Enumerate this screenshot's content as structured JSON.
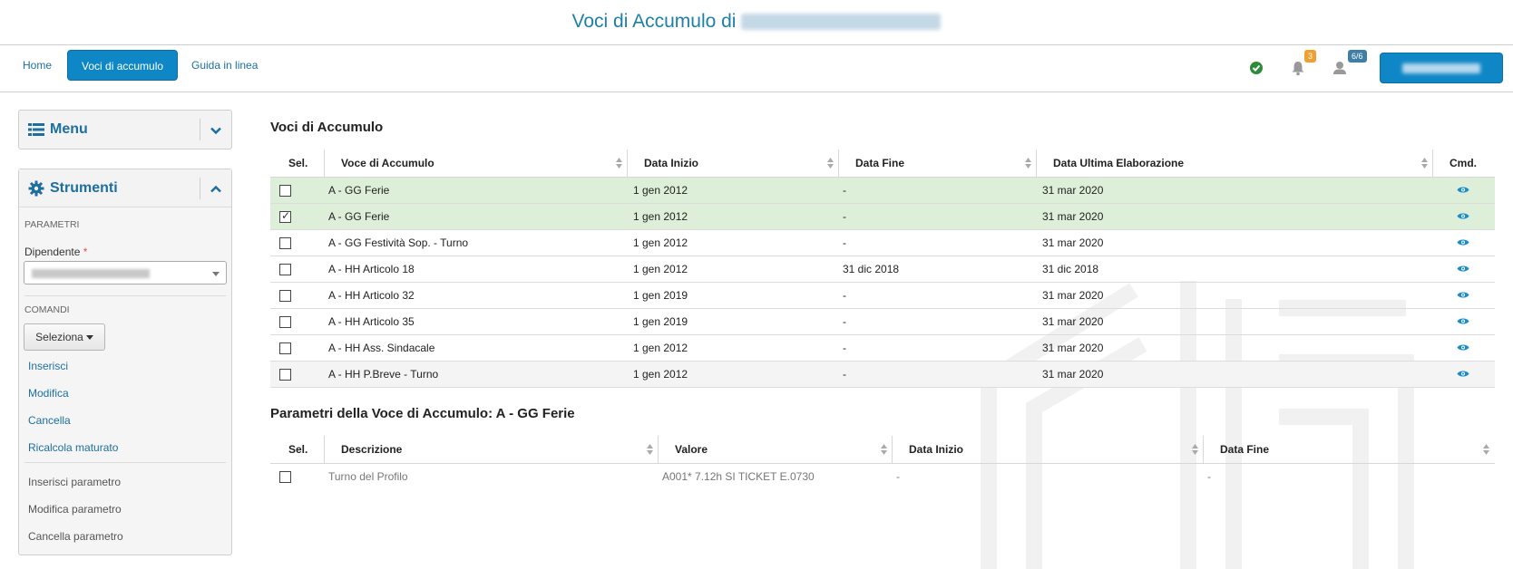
{
  "header": {
    "title": "Voci di Accumulo di"
  },
  "nav": {
    "home": "Home",
    "voci": "Voci di accumulo",
    "guida": "Guida in linea",
    "notifications_count": "3",
    "users_count": "6/6"
  },
  "sidebar": {
    "menu_title": "Menu",
    "tools_title": "Strumenti",
    "parametri_label": "PARAMETRI",
    "dipendente_label": "Dipendente",
    "required_mark": "*",
    "comandi_label": "COMANDI",
    "seleziona_label": "Seleziona",
    "commands": [
      "Inserisci",
      "Modifica",
      "Cancella",
      "Ricalcola maturato"
    ],
    "param_commands": [
      "Inserisci parametro",
      "Modifica parametro",
      "Cancella parametro"
    ]
  },
  "voci": {
    "title": "Voci di Accumulo",
    "columns": [
      "Sel.",
      "Voce di Accumulo",
      "Data Inizio",
      "Data Fine",
      "Data Ultima Elaborazione",
      "Cmd."
    ],
    "rows": [
      {
        "voce": "A - GG Ferie",
        "inizio": "1 gen 2012",
        "fine": "-",
        "ultima": "31 mar 2020",
        "checked": false,
        "style": "green"
      },
      {
        "voce": "A - GG Ferie",
        "inizio": "1 gen 2012",
        "fine": "-",
        "ultima": "31 mar 2020",
        "checked": true,
        "style": "green"
      },
      {
        "voce": "A - GG Festività Sop. - Turno",
        "inizio": "1 gen 2012",
        "fine": "-",
        "ultima": "31 mar 2020",
        "checked": false,
        "style": ""
      },
      {
        "voce": "A - HH Articolo 18",
        "inizio": "1 gen 2012",
        "fine": "31 dic 2018",
        "ultima": "31 dic 2018",
        "checked": false,
        "style": ""
      },
      {
        "voce": "A - HH Articolo 32",
        "inizio": "1 gen 2019",
        "fine": "-",
        "ultima": "31 mar 2020",
        "checked": false,
        "style": ""
      },
      {
        "voce": "A - HH Articolo 35",
        "inizio": "1 gen 2019",
        "fine": "-",
        "ultima": "31 mar 2020",
        "checked": false,
        "style": ""
      },
      {
        "voce": "A - HH Ass. Sindacale",
        "inizio": "1 gen 2012",
        "fine": "-",
        "ultima": "31 mar 2020",
        "checked": false,
        "style": ""
      },
      {
        "voce": "A - HH P.Breve - Turno",
        "inizio": "1 gen 2012",
        "fine": "-",
        "ultima": "31 mar 2020",
        "checked": false,
        "style": "grey"
      }
    ]
  },
  "parametri": {
    "title": "Parametri della Voce di Accumulo: A - GG Ferie",
    "columns": [
      "Sel.",
      "Descrizione",
      "Valore",
      "Data Inizio",
      "Data Fine"
    ],
    "rows": [
      {
        "descrizione": "Turno del Profilo",
        "valore": "A001* 7.12h SI TICKET E.0730",
        "inizio": "-",
        "fine": "-"
      }
    ]
  },
  "colors": {
    "accent": "#0f87c6",
    "link": "#1e6fa0",
    "selected_row": "#ddefd8",
    "success": "#2e8b3a",
    "warning_badge": "#f0a030"
  }
}
